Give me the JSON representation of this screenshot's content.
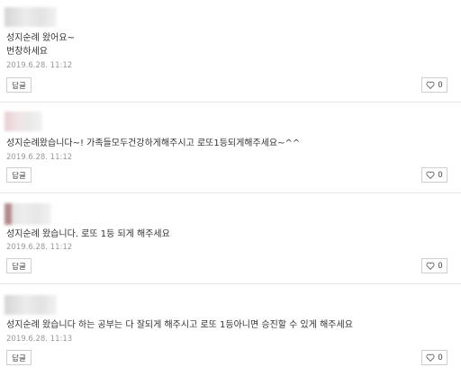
{
  "comments": [
    {
      "lines": [
        "성지순례 왔어요~",
        "번창하세요"
      ],
      "date": "2019.6.28. 11:12",
      "reply_label": "답글",
      "like_count": "0"
    },
    {
      "lines": [
        "성지순례왔습니다~! 가족들모두건강하게해주시고 로또1등되게해주세요~^^"
      ],
      "date": "2019.6.28. 11:12",
      "reply_label": "답글",
      "like_count": "0"
    },
    {
      "lines": [
        "성지순례 왔습니다. 로또 1등 되게 해주세요"
      ],
      "date": "2019.6.28. 11:12",
      "reply_label": "답글",
      "like_count": "0"
    },
    {
      "lines": [
        "성지순례 왔습니다 하는 공부는 다 잘되게 해주시고 로또 1등아니면 승진할 수 있게 해주세요"
      ],
      "date": "2019.6.28. 11:13",
      "reply_label": "답글",
      "like_count": "0"
    }
  ],
  "icons": {
    "like": "heart-outline-icon"
  }
}
